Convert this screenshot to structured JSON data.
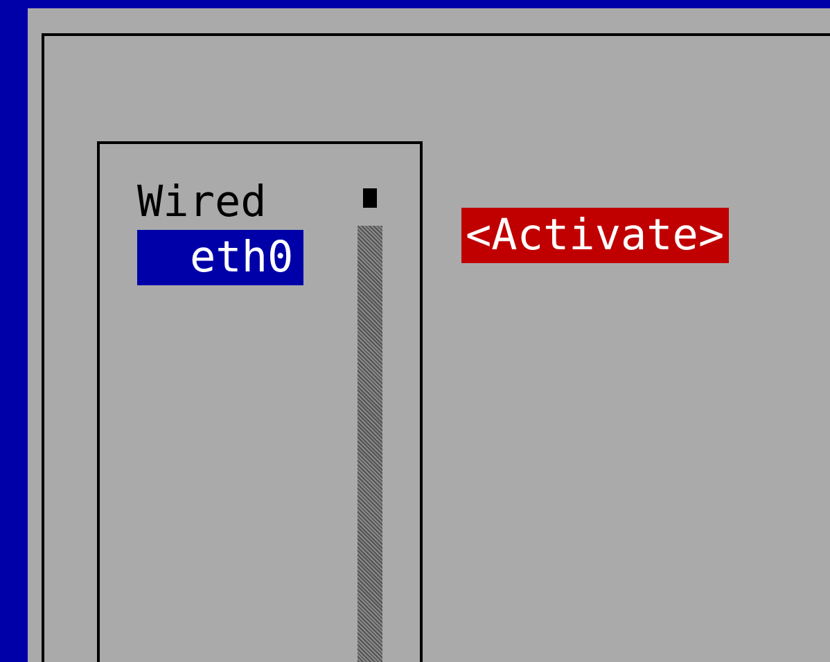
{
  "connections": [
    {
      "label": "Wired",
      "kind": "header",
      "selected": false
    },
    {
      "label": "eth0",
      "kind": "device",
      "selected": true
    }
  ],
  "button": {
    "label": "<Activate>",
    "focused": true
  }
}
